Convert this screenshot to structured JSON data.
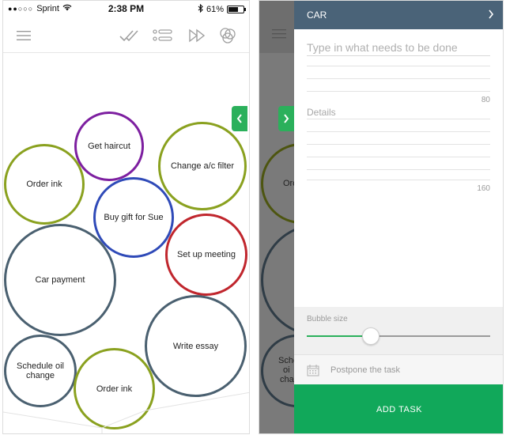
{
  "status_bar": {
    "carrier": "Sprint",
    "time": "2:38 PM",
    "battery": "61%",
    "battery_level": 0.61
  },
  "toolbar": {
    "icons": [
      "menu-icon",
      "checkmarks-icon",
      "list-icon",
      "fast-forward-icon",
      "circles-icon"
    ]
  },
  "bubbles": [
    {
      "label": "Get haircut",
      "color": "#7d1fa0"
    },
    {
      "label": "Change a/c filter",
      "color": "#8aa11f"
    },
    {
      "label": "Order ink",
      "color": "#8aa11f"
    },
    {
      "label": "Buy gift for Sue",
      "color": "#2f4ab8"
    },
    {
      "label": "Set up meeting",
      "color": "#c0262d"
    },
    {
      "label": "Car payment",
      "color": "#4a6070"
    },
    {
      "label": "Write essay",
      "color": "#4a6070"
    },
    {
      "label": "Schedule oil change",
      "color": "#4a6070"
    },
    {
      "label": "Order ink",
      "color": "#8aa11f"
    }
  ],
  "partial_labels": {
    "order_ink": "Ord",
    "schedule": "Sche",
    "schedule_2": "oi",
    "schedule_3": "cha"
  },
  "panel": {
    "category": "CAR",
    "title_placeholder": "Type in what needs to be done",
    "title_max": "80",
    "details_placeholder": "Details",
    "details_max": "160",
    "bubble_size_label": "Bubble size",
    "bubble_size_value": 0.35,
    "postpone_label": "Postpone the task",
    "add_task_label": "ADD TASK"
  },
  "colors": {
    "accent": "#11a85a",
    "header": "#4a6378"
  }
}
